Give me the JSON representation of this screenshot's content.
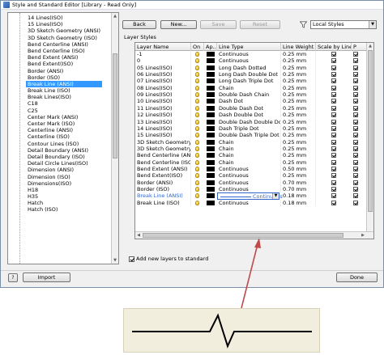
{
  "window": {
    "title": "Style and Standard Editor [Library - Read Only]"
  },
  "tree": {
    "items": [
      "14 Lines(ISO)",
      "15 Lines(ISO)",
      "3D Sketch Geometry (ANSI)",
      "3D Sketch Geometry (ISO)",
      "Bend Centerline (ANSI)",
      "Bend Centerline (ISO)",
      "Bend Extent (ANSI)",
      "Bend Extent(ISO)",
      "Border (ANSI)",
      "Border (ISO)",
      "Break Line (ANSI)",
      "Break Line (ISO)",
      "Break Lines(ISO)",
      "C18",
      "C25",
      "Center Mark (ANSI)",
      "Center Mark (ISO)",
      "Centerline (ANSI)",
      "Centerline (ISO)",
      "Contour Lines (ISO)",
      "Detail Boundary (ANSI)",
      "Detail Boundary (ISO)",
      "Detail Circle Lines(ISO)",
      "Dimension (ANSI)",
      "Dimension (ISO)",
      "Dimensions(ISO)",
      "H18",
      "H35",
      "Hatch",
      "Hatch (ISO)"
    ],
    "selected_index": 10
  },
  "toolbar": {
    "back": "Back",
    "new": "New...",
    "save": "Save",
    "reset": "Reset",
    "filter_select": "Local Styles"
  },
  "layer_styles": {
    "group_label": "Layer Styles",
    "columns": [
      "Layer Name",
      "On",
      "Ap...",
      "Line Type",
      "Line Weight",
      "Scale by Line ...",
      "P"
    ],
    "rows": [
      {
        "name": "-1",
        "line_type": "Continuous",
        "weight": "0.25 mm"
      },
      {
        "name": "0",
        "line_type": "Continuous",
        "weight": "0.25 mm"
      },
      {
        "name": "05 Lines(ISO)",
        "line_type": "Long Dash Dotted",
        "weight": "0.25 mm"
      },
      {
        "name": "06 Lines(ISO)",
        "line_type": "Long Dash Double Dot",
        "weight": "0.25 mm"
      },
      {
        "name": "07 Lines(ISO)",
        "line_type": "Long Dash Triple Dot",
        "weight": "0.25 mm"
      },
      {
        "name": "08 Lines(ISO)",
        "line_type": "Chain",
        "weight": "0.25 mm"
      },
      {
        "name": "09 Lines(ISO)",
        "line_type": "Double Dash Chain",
        "weight": "0.25 mm"
      },
      {
        "name": "10 Lines(ISO)",
        "line_type": "Dash Dot",
        "weight": "0.25 mm"
      },
      {
        "name": "11 Lines(ISO)",
        "line_type": "Double Dash Dot",
        "weight": "0.25 mm"
      },
      {
        "name": "12 Lines(ISO)",
        "line_type": "Dash Double Dot",
        "weight": "0.25 mm"
      },
      {
        "name": "13 Lines(ISO)",
        "line_type": "Double Dash Double Dot",
        "weight": "0.25 mm"
      },
      {
        "name": "14 Lines(ISO)",
        "line_type": "Dash Triple Dot",
        "weight": "0.25 mm"
      },
      {
        "name": "15 Lines(ISO)",
        "line_type": "Double Dash Triple Dot",
        "weight": "0.25 mm"
      },
      {
        "name": "3D Sketch Geometry (A",
        "line_type": "Chain",
        "weight": "0.25 mm"
      },
      {
        "name": "3D Sketch Geometry (IS",
        "line_type": "Chain",
        "weight": "0.25 mm"
      },
      {
        "name": "Bend Centerline (ANSI)",
        "line_type": "Chain",
        "weight": "0.25 mm"
      },
      {
        "name": "Bend Centerline (ISO)",
        "line_type": "Chain",
        "weight": "0.25 mm"
      },
      {
        "name": "Bend Extent (ANSI)",
        "line_type": "Continuous",
        "weight": "0.50 mm"
      },
      {
        "name": "Bend Extent(ISO)",
        "line_type": "Continuous",
        "weight": "0.25 mm"
      },
      {
        "name": "Border (ANSI)",
        "line_type": "Continuous",
        "weight": "0.70 mm"
      },
      {
        "name": "Border (ISO)",
        "line_type": "Continuous",
        "weight": "0.70 mm"
      },
      {
        "name": "Break Line (ANSI)",
        "line_type": "Continuous",
        "weight": "0.18 mm"
      },
      {
        "name": "Break Line (ISO)",
        "line_type": "Continuous",
        "weight": "0.18 mm"
      }
    ],
    "editing_row": 21
  },
  "add_new_label": "Add new layers to standard",
  "footer": {
    "help": "?",
    "import": "Import",
    "done": "Done"
  }
}
